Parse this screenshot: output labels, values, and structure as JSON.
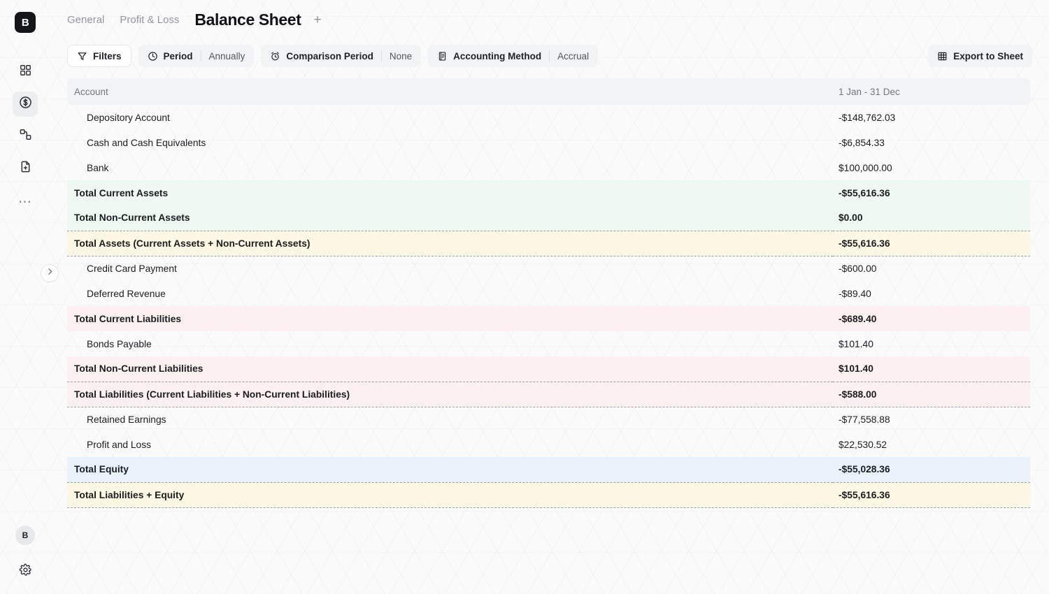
{
  "app": {
    "logo_text": "B",
    "avatar_initial": "B"
  },
  "sidebar": {
    "items": [
      {
        "name": "dashboard",
        "icon": "grid-icon",
        "active": false
      },
      {
        "name": "finance",
        "icon": "dollar-circle-icon",
        "active": true
      },
      {
        "name": "workflows",
        "icon": "nodes-icon",
        "active": false
      },
      {
        "name": "new-document",
        "icon": "file-plus-icon",
        "active": false
      },
      {
        "name": "more",
        "icon": "ellipsis-icon",
        "active": false
      }
    ],
    "more_glyph": "⋯",
    "settings_icon": "gear-icon",
    "collapse_icon": "chevron-right-icon"
  },
  "tabs": {
    "items": [
      {
        "label": "General",
        "active": false
      },
      {
        "label": "Profit & Loss",
        "active": false
      },
      {
        "label": "Balance Sheet",
        "active": true
      }
    ],
    "add_label": "+"
  },
  "toolbar": {
    "filters_label": "Filters",
    "period_label": "Period",
    "period_value": "Annually",
    "comparison_label": "Comparison Period",
    "comparison_value": "None",
    "accounting_method_label": "Accounting Method",
    "accounting_method_value": "Accrual",
    "export_label": "Export to Sheet"
  },
  "table": {
    "headers": {
      "account": "Account",
      "period": "1 Jan - 31 Dec"
    },
    "rows": [
      {
        "account": "Depository Account",
        "value": "-$148,762.03",
        "kind": "leaf",
        "tint": "none"
      },
      {
        "account": "Cash and Cash Equivalents",
        "value": "-$6,854.33",
        "kind": "leaf",
        "tint": "none"
      },
      {
        "account": "Bank",
        "value": "$100,000.00",
        "kind": "leaf",
        "tint": "none"
      },
      {
        "account": "Total Current Assets",
        "value": "-$55,616.36",
        "kind": "total",
        "tint": "green"
      },
      {
        "account": "Total Non-Current Assets",
        "value": "$0.00",
        "kind": "total",
        "tint": "green"
      },
      {
        "account": "Total Assets (Current Assets + Non-Current Assets)",
        "value": "-$55,616.36",
        "kind": "total",
        "tint": "yellow",
        "rules": "both"
      },
      {
        "account": "Credit Card Payment",
        "value": "-$600.00",
        "kind": "leaf",
        "tint": "none"
      },
      {
        "account": "Deferred Revenue",
        "value": "-$89.40",
        "kind": "leaf",
        "tint": "none"
      },
      {
        "account": "Total Current Liabilities",
        "value": "-$689.40",
        "kind": "total",
        "tint": "red"
      },
      {
        "account": "Bonds Payable",
        "value": "$101.40",
        "kind": "leaf",
        "tint": "none"
      },
      {
        "account": "Total Non-Current Liabilities",
        "value": "$101.40",
        "kind": "total",
        "tint": "red"
      },
      {
        "account": "Total Liabilities (Current Liabilities + Non-Current Liabilities)",
        "value": "-$588.00",
        "kind": "total",
        "tint": "red",
        "rules": "both"
      },
      {
        "account": "Retained Earnings",
        "value": "-$77,558.88",
        "kind": "leaf",
        "tint": "none"
      },
      {
        "account": "Profit and Loss",
        "value": "$22,530.52",
        "kind": "leaf",
        "tint": "none"
      },
      {
        "account": "Total Equity",
        "value": "-$55,028.36",
        "kind": "total",
        "tint": "blue"
      },
      {
        "account": "Total Liabilities + Equity",
        "value": "-$55,616.36",
        "kind": "total",
        "tint": "yellow",
        "rules": "both"
      }
    ]
  },
  "colors": {
    "accent_dark": "#15161a",
    "tint_green": "#eef9f1",
    "tint_red": "#fdf0f0",
    "tint_blue": "#e9f2fb",
    "tint_yellow": "#fdf8e4",
    "header_bg": "#f1f3f5",
    "muted_text": "#74777e"
  }
}
